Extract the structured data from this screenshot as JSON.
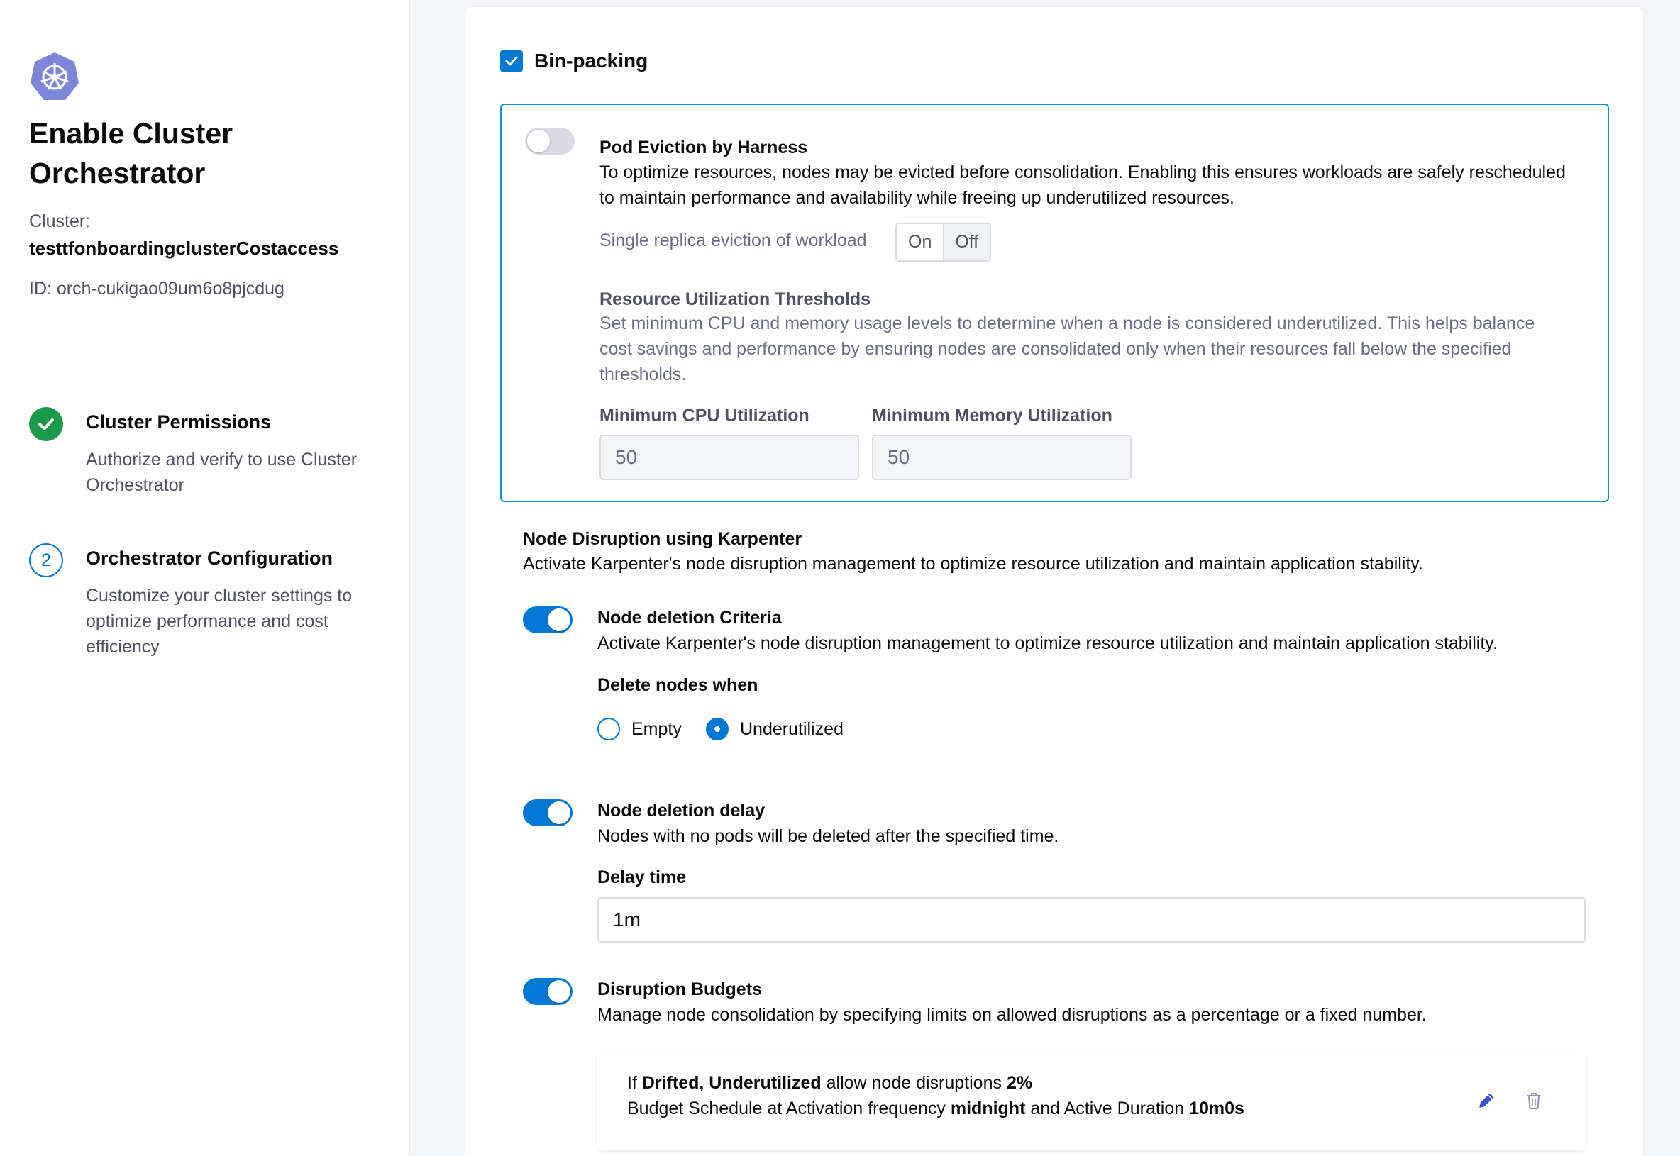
{
  "sidebar": {
    "title": "Enable Cluster Orchestrator",
    "cluster_label": "Cluster:",
    "cluster_name": "testtfonboardingclusterCostaccess",
    "cluster_id": "ID: orch-cukigao09um6o8pjcdug",
    "steps": [
      {
        "status": "complete",
        "number": "",
        "title": "Cluster Permissions",
        "description": "Authorize and verify to use Cluster Orchestrator"
      },
      {
        "status": "current",
        "number": "2",
        "title": "Orchestrator Configuration",
        "description": "Customize your cluster settings to optimize performance and cost efficiency"
      }
    ]
  },
  "main": {
    "bin_packing": {
      "label": "Bin-packing",
      "checked": true
    },
    "pod_eviction": {
      "enabled": false,
      "title": "Pod Eviction by Harness",
      "description": "To optimize resources, nodes may be evicted before consolidation. Enabling this ensures workloads are safely rescheduled to maintain performance and availability while freeing up underutilized resources.",
      "single_replica_label": "Single replica eviction of workload",
      "single_replica_options": [
        "On",
        "Off"
      ],
      "single_replica_selected": "Off",
      "thresholds_title": "Resource Utilization Thresholds",
      "thresholds_description": "Set minimum CPU and memory usage levels to determine when a node is considered underutilized. This helps balance cost savings and performance by ensuring nodes are consolidated only when their resources fall below the specified thresholds.",
      "cpu_label": "Minimum CPU Utilization",
      "cpu_value": "50",
      "memory_label": "Minimum Memory Utilization",
      "memory_value": "50"
    },
    "karpenter": {
      "title": "Node Disruption using Karpenter",
      "description": "Activate Karpenter's node disruption management to optimize resource utilization and maintain application stability."
    },
    "node_deletion_criteria": {
      "enabled": true,
      "title": "Node deletion Criteria",
      "description": "Activate Karpenter's node disruption management to optimize resource utilization and maintain application stability.",
      "delete_when_label": "Delete nodes when",
      "options": [
        "Empty",
        "Underutilized"
      ],
      "selected": "Underutilized"
    },
    "node_deletion_delay": {
      "enabled": true,
      "title": "Node deletion delay",
      "description": "Nodes with no pods will be deleted after the specified time.",
      "delay_label": "Delay time",
      "delay_value": "1m"
    },
    "disruption_budgets": {
      "enabled": true,
      "title": "Disruption Budgets",
      "description": "Manage node consolidation by specifying limits on allowed disruptions as a percentage or a fixed number.",
      "budget": {
        "prefix": "If",
        "reasons": "Drifted, Underutilized",
        "middle": "allow node disruptions",
        "value": "2%",
        "schedule_prefix": "Budget Schedule at Activation frequency",
        "frequency": "midnight",
        "duration_prefix": "and Active Duration",
        "duration": "10m0s"
      }
    }
  },
  "colors": {
    "primary": "#0278d5",
    "success": "#1b9a4a",
    "logo": "#7d86d9"
  },
  "icons": [
    "kubernetes-logo-icon",
    "check-icon",
    "checkbox-check-icon",
    "edit-icon",
    "delete-icon"
  ]
}
